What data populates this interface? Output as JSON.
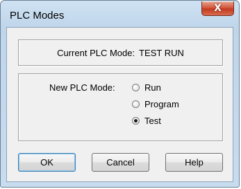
{
  "window": {
    "title": "PLC Modes",
    "close_glyph": "X"
  },
  "current": {
    "label": "Current PLC Mode:",
    "value": "TEST RUN"
  },
  "new_mode": {
    "label": "New PLC Mode:",
    "options": [
      {
        "label": "Run",
        "checked": false
      },
      {
        "label": "Program",
        "checked": false
      },
      {
        "label": "Test",
        "checked": true
      }
    ]
  },
  "buttons": {
    "ok": "OK",
    "cancel": "Cancel",
    "help": "Help"
  },
  "colors": {
    "frame": "#bfd5ea",
    "close_red": "#c23a1f",
    "dialog_bg": "#f0f0f0",
    "default_button_border": "#3c7fb1"
  },
  "icons": {
    "close": "close-icon"
  }
}
